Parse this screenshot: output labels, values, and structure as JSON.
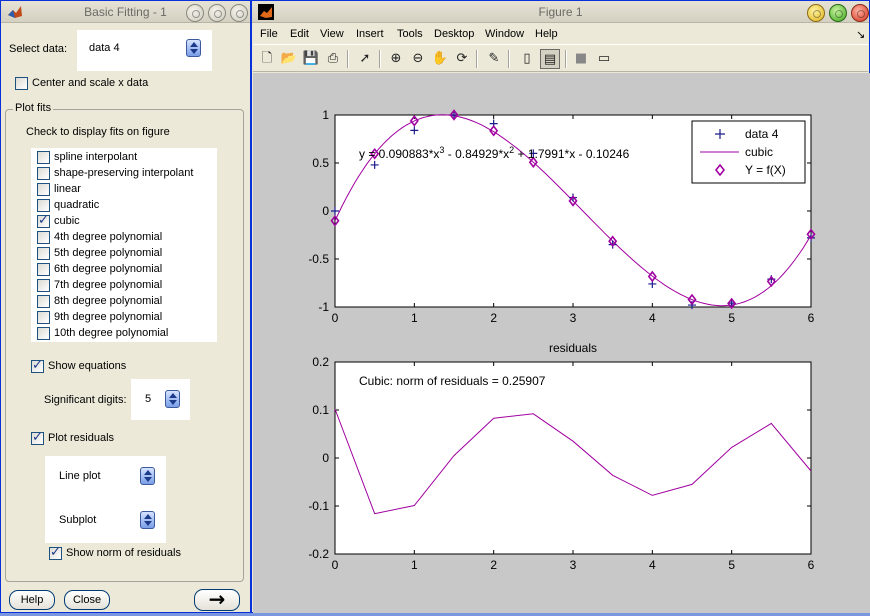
{
  "basic_fitting": {
    "title": "Basic Fitting - 1",
    "select_data_label": "Select data:",
    "select_data_value": "data 4",
    "center_scale_label": "Center and scale x data",
    "center_scale_checked": false,
    "plot_fits_group": "Plot fits",
    "check_display_label": "Check to display fits on figure",
    "fits": [
      {
        "label": "spline interpolant",
        "checked": false
      },
      {
        "label": "shape-preserving interpolant",
        "checked": false
      },
      {
        "label": "linear",
        "checked": false
      },
      {
        "label": "quadratic",
        "checked": false
      },
      {
        "label": "cubic",
        "checked": true
      },
      {
        "label": "4th degree polynomial",
        "checked": false
      },
      {
        "label": "5th degree polynomial",
        "checked": false
      },
      {
        "label": "6th degree polynomial",
        "checked": false
      },
      {
        "label": "7th degree polynomial",
        "checked": false
      },
      {
        "label": "8th degree polynomial",
        "checked": false
      },
      {
        "label": "9th degree polynomial",
        "checked": false
      },
      {
        "label": "10th degree polynomial",
        "checked": false
      }
    ],
    "show_equations_label": "Show equations",
    "show_equations_checked": true,
    "significant_digits_label": "Significant digits:",
    "significant_digits_value": "5",
    "plot_residuals_label": "Plot residuals",
    "plot_residuals_checked": true,
    "residual_plot_type": "Line plot",
    "residual_location": "Subplot",
    "show_norm_label": "Show norm of residuals",
    "show_norm_checked": true,
    "help_button": "Help",
    "close_button": "Close",
    "next_arrow": "→"
  },
  "figure": {
    "title": "Figure 1",
    "menu": [
      "File",
      "Edit",
      "View",
      "Insert",
      "Tools",
      "Desktop",
      "Window",
      "Help"
    ],
    "toolbar_icons": [
      "new-file-icon",
      "open-folder-icon",
      "save-icon",
      "print-icon",
      "pointer-icon",
      "zoom-in-icon",
      "zoom-out-icon",
      "pan-hand-icon",
      "rotate-3d-icon",
      "data-cursor-icon",
      "colorbar-icon",
      "legend-icon",
      "hide-plot-tools-icon",
      "show-plot-tools-icon"
    ],
    "colors": {
      "data": "#1a1a8c",
      "fit": "#a000a0",
      "figure_bg": "#c8c8c8"
    }
  },
  "chart_data": [
    {
      "type": "scatter",
      "equation": "y = 0.090883*x^3 - 0.84929*x^2 + 1.7991*x - 0.10246",
      "equation_parts": {
        "a": "y = 0.090883*x",
        "b": " - 0.84929*x",
        "c": " + 1.7991*x - 0.10246",
        "exp3": "3",
        "exp2": "2"
      },
      "xlim": [
        0,
        6
      ],
      "ylim": [
        -1,
        1
      ],
      "xticks": [
        "0",
        "1",
        "2",
        "3",
        "4",
        "5",
        "6"
      ],
      "yticks": [
        "1",
        "0.5",
        "0",
        "-0.5",
        "-1"
      ],
      "legend_position": "top-right",
      "legend": [
        "data 4",
        "cubic",
        "Y = f(X)"
      ],
      "series": [
        {
          "name": "data 4",
          "marker": "+",
          "x": [
            0,
            0.5,
            1,
            1.5,
            2,
            2.5,
            3,
            3.5,
            4,
            4.5,
            5,
            5.5,
            6
          ],
          "y": [
            0,
            0.48,
            0.84,
            1.0,
            0.91,
            0.6,
            0.14,
            -0.35,
            -0.76,
            -0.98,
            -0.96,
            -0.71,
            -0.28
          ]
        },
        {
          "name": "cubic",
          "line": true,
          "coeffs": [
            0.090883,
            -0.84929,
            1.7991,
            -0.10246
          ]
        },
        {
          "name": "Y = f(X)",
          "marker": "diamond",
          "x": [
            0,
            0.5,
            1,
            1.5,
            2,
            2.5,
            3,
            3.5,
            4,
            4.5,
            5,
            5.5,
            6
          ],
          "y": [
            -0.102,
            0.596,
            0.939,
            1.0,
            0.836,
            0.508,
            0.105,
            -0.315,
            -0.682,
            -0.922,
            -0.963,
            -0.733,
            -0.242
          ]
        }
      ]
    },
    {
      "type": "line",
      "title": "residuals",
      "annotation": "Cubic: norm of residuals = 0.25907",
      "xlim": [
        0,
        6
      ],
      "ylim": [
        -0.2,
        0.2
      ],
      "xticks": [
        "0",
        "1",
        "2",
        "3",
        "4",
        "5",
        "6"
      ],
      "yticks": [
        "0.2",
        "0.1",
        "0",
        "-0.1",
        "-0.2"
      ],
      "x": [
        0,
        0.5,
        1,
        1.5,
        2,
        2.5,
        3,
        3.5,
        4,
        4.5,
        5,
        5.5,
        6
      ],
      "y": [
        0.102,
        -0.116,
        -0.099,
        0.005,
        0.083,
        0.092,
        0.035,
        -0.036,
        -0.078,
        -0.055,
        0.022,
        0.072,
        -0.027
      ]
    }
  ]
}
